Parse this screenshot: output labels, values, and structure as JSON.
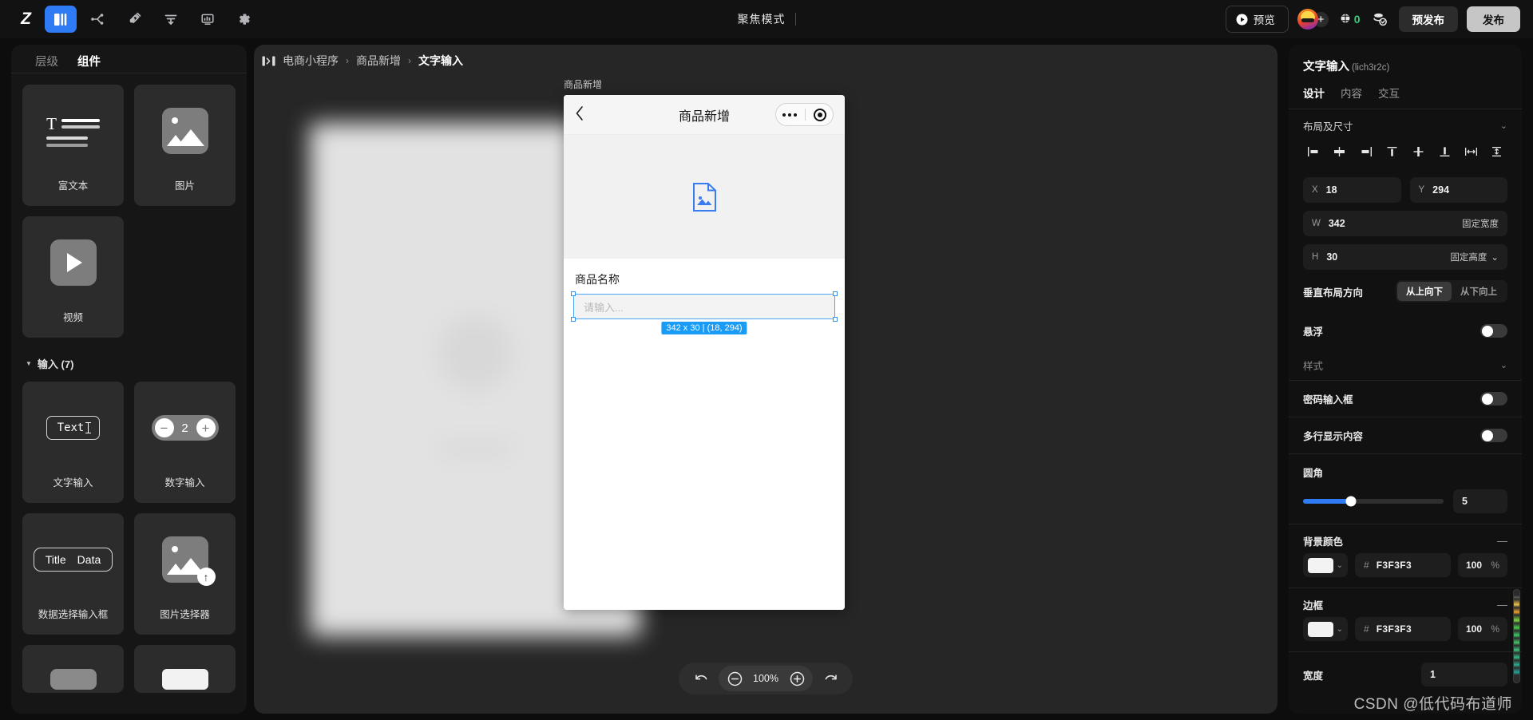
{
  "topbar": {
    "logo": "Z",
    "tools": [
      {
        "name": "pages-icon",
        "active": true
      },
      {
        "name": "flow-icon",
        "active": false
      },
      {
        "name": "plugin-icon",
        "active": false
      },
      {
        "name": "data-model-icon",
        "active": false
      },
      {
        "name": "dashboard-icon",
        "active": false
      },
      {
        "name": "settings-icon",
        "active": false
      }
    ],
    "center_title": "聚焦模式",
    "preview_label": "预览",
    "coin_count": "0",
    "prepublish_label": "预发布",
    "publish_label": "发布"
  },
  "left_panel": {
    "tabs": [
      {
        "label": "层级",
        "active": false
      },
      {
        "label": "组件",
        "active": true
      }
    ],
    "components": [
      {
        "label": "富文本",
        "icon": "rich-text-icon"
      },
      {
        "label": "图片",
        "icon": "image-icon"
      },
      {
        "label": "视频",
        "icon": "video-icon"
      }
    ],
    "group": {
      "label": "输入 (7)",
      "items": [
        {
          "label": "文字输入",
          "icon": "text-input-icon",
          "sample": "Text"
        },
        {
          "label": "数字输入",
          "icon": "number-input-icon",
          "sample": "2"
        },
        {
          "label": "数据选择输入框",
          "icon": "data-select-icon",
          "sample_title": "Title",
          "sample_data": "Data"
        },
        {
          "label": "图片选择器",
          "icon": "image-picker-icon"
        }
      ]
    }
  },
  "canvas": {
    "breadcrumb": {
      "icon": "panel-toggle-icon",
      "items": [
        "电商小程序",
        "商品新增",
        "文字输入"
      ],
      "separator": "›"
    },
    "page_label": "商品新增",
    "phone": {
      "nav_back_icon": "chevron-left-icon",
      "nav_title": "商品新增",
      "capsule": {
        "dots_icon": "more-dots-icon",
        "target_icon": "target-icon"
      },
      "hero_icon": "image-placeholder-icon",
      "field_label": "商品名称",
      "input_placeholder": "请输入...",
      "selection_badge": "342 x 30 | (18, 294)"
    },
    "zoombar": {
      "undo_icon": "undo-icon",
      "zoom_out_icon": "minus-circle-icon",
      "zoom_level": "100%",
      "zoom_in_icon": "plus-circle-icon",
      "redo_icon": "redo-icon"
    }
  },
  "right_panel": {
    "component_name": "文字输入",
    "component_id": "(lich3r2c)",
    "tabs": [
      {
        "label": "设计",
        "active": true
      },
      {
        "label": "内容",
        "active": false
      },
      {
        "label": "交互",
        "active": false
      }
    ],
    "layout_section": {
      "title": "布局及尺寸",
      "align_icons": [
        "align-left-icon",
        "align-center-horizontal-icon",
        "align-right-icon",
        "align-top-icon",
        "align-middle-vertical-icon",
        "align-bottom-icon",
        "distribute-horizontal-icon",
        "distribute-vertical-icon"
      ],
      "x": {
        "key": "X",
        "value": "18"
      },
      "y": {
        "key": "Y",
        "value": "294"
      },
      "w": {
        "key": "W",
        "value": "342",
        "mode": "固定宽度"
      },
      "h": {
        "key": "H",
        "value": "30",
        "mode": "固定高度"
      },
      "vertical_direction": {
        "label": "垂直布局方向",
        "options": [
          {
            "label": "从上向下",
            "active": true
          },
          {
            "label": "从下向上",
            "active": false
          }
        ]
      },
      "floating": {
        "label": "悬浮",
        "on": false
      }
    },
    "style_section": {
      "title": "样式",
      "password_input": {
        "label": "密码输入框",
        "on": false
      },
      "multiline": {
        "label": "多行显示内容",
        "on": false
      },
      "radius": {
        "label": "圆角",
        "value": "5",
        "percent": 34
      },
      "background_color": {
        "label": "背景颜色",
        "hex": "F3F3F3",
        "opacity": "100",
        "unit": "%",
        "swatch": "#F3F3F3"
      },
      "border": {
        "label": "边框",
        "hex": "F3F3F3",
        "opacity": "100",
        "unit": "%",
        "swatch": "#F3F3F3"
      },
      "width": {
        "label": "宽度",
        "value": "1"
      }
    }
  },
  "watermark": "CSDN @低代码布道师",
  "colors": {
    "accent": "#2f7bf6",
    "selection": "#1a9bf5",
    "panel_bg": "#161616",
    "canvas_bg": "#262626"
  }
}
